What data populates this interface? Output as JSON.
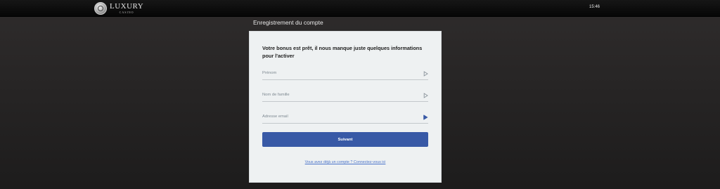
{
  "brand": {
    "name": "LUXURY",
    "sub": "CASINO"
  },
  "header": {
    "time": "15:46"
  },
  "page": {
    "heading": "Enregistrement du compte"
  },
  "form": {
    "title": "Votre bonus est prêt, il nous manque juste quelques informations pour l'activer",
    "fields": [
      {
        "label": "Prénom",
        "icon": "play-icon",
        "value": ""
      },
      {
        "label": "Nom de famille",
        "icon": "play-icon",
        "value": ""
      },
      {
        "label": "Adresse email",
        "icon": "play-icon",
        "value": ""
      }
    ],
    "submit_label": "Suivant",
    "login_link": "Vous avez déjà un compte ? Connectez-vous ici"
  },
  "colors": {
    "accent": "#3859a6",
    "link": "#4a73c9",
    "background": "#272525",
    "card": "#eef1f2"
  }
}
